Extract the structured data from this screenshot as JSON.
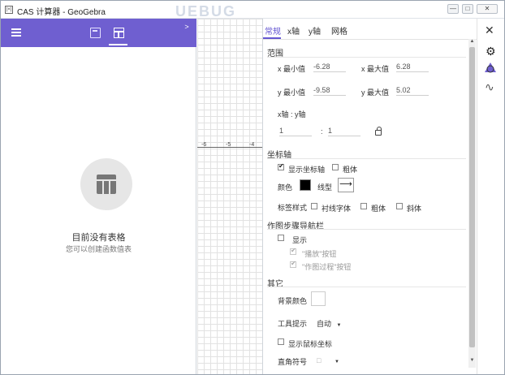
{
  "window": {
    "title": "CAS 计算器 - GeoGebra",
    "icon_glyph": "|×|",
    "watermark": "UEBUG",
    "buttons": {
      "minimize": "—",
      "maximize": "□",
      "close": "✕"
    }
  },
  "left_panel": {
    "empty_title": "目前没有表格",
    "empty_subtitle": "您可以创建函数值表",
    "toolbar_color": "#6f5fd0"
  },
  "graph": {
    "toggle_glyph": ">",
    "ticks": [
      "-6",
      "-5",
      "-4"
    ]
  },
  "settings": {
    "tabs": [
      "常规",
      "x轴",
      "y轴",
      "网格"
    ],
    "range": {
      "section": "范围",
      "x_min_label": "x 最小值",
      "x_min": "-6.28",
      "x_max_label": "x 最大值",
      "x_max": "6.28",
      "y_min_label": "y 最小值",
      "y_min": "-9.58",
      "y_max_label": "y 最大值",
      "y_max": "5.02",
      "ratio_label": "x轴 : y轴",
      "ratio_x": "1",
      "ratio_sep": ":",
      "ratio_y": "1"
    },
    "axes": {
      "section": "坐标轴",
      "show_axes": "显示坐标轴",
      "bold": "粗体",
      "color_label": "颜色",
      "color": "#000000",
      "linestyle_label": "线型",
      "linestyle_glyph": "⟶",
      "label_style": "标签样式",
      "serif": "衬线字体",
      "bold2": "粗体",
      "italic": "斜体"
    },
    "nav_bar": {
      "section": "作图步骤导航栏",
      "show": "显示",
      "play_button": "\"播放\"按钮",
      "construction_button": "\"作图过程\"按钮"
    },
    "misc": {
      "section": "其它",
      "bg_color_label": "背景颜色",
      "bg_color": "#ffffff",
      "tooltips_label": "工具提示",
      "tooltips_value": "自动",
      "show_mouse_coords": "显示鼠标坐标",
      "right_angle_label": "直角符号",
      "right_angle_value": "□"
    }
  },
  "right_column": {
    "close": "✕",
    "gear": "⚙",
    "func": "∿"
  },
  "accent": "#6557d2"
}
